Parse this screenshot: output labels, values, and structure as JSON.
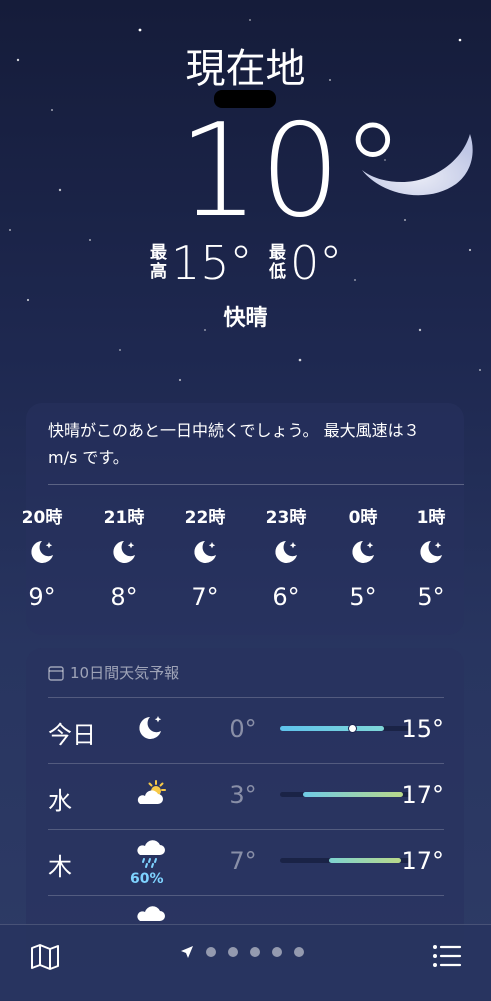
{
  "header": {
    "location": "現在地",
    "temperature": "10°",
    "high_label_1": "最",
    "high_label_2": "高",
    "high": "15°",
    "low_label_1": "最",
    "low_label_2": "低",
    "low": "0°",
    "condition": "快晴"
  },
  "hourly": {
    "summary": "快晴がこのあと一日中続くでしょう。 最大風速は３ m/s です。",
    "items": [
      {
        "time": "20時",
        "icon": "moon-stars-icon",
        "temp": "9°"
      },
      {
        "time": "21時",
        "icon": "moon-stars-icon",
        "temp": "8°"
      },
      {
        "time": "22時",
        "icon": "moon-stars-icon",
        "temp": "7°"
      },
      {
        "time": "23時",
        "icon": "moon-stars-icon",
        "temp": "6°"
      },
      {
        "time": "0時",
        "icon": "moon-stars-icon",
        "temp": "5°"
      },
      {
        "time": "1時",
        "icon": "moon-stars-icon",
        "temp": "5°"
      }
    ]
  },
  "forecast": {
    "title": "10日間天気予報",
    "days": [
      {
        "day": "今日",
        "icon": "moon-stars-icon",
        "low": "0°",
        "high": "15°",
        "range_start": 0.0,
        "range_end": 0.8,
        "current": 0.55,
        "fill": "linear-gradient(90deg,#5fc3ec,#7fd7d8)"
      },
      {
        "day": "水",
        "icon": "partly-sunny-icon",
        "low": "3°",
        "high": "17°",
        "range_start": 0.18,
        "range_end": 0.95,
        "fill": "linear-gradient(90deg,#6fcbe6,#b9d98a)"
      },
      {
        "day": "木",
        "icon": "rain-cloud-icon",
        "probability": "60%",
        "low": "7°",
        "high": "17°",
        "range_start": 0.38,
        "range_end": 0.93,
        "fill": "linear-gradient(90deg,#7ed3d0,#b9d98a)"
      }
    ]
  },
  "colors": {
    "background_top": "#151c3a",
    "background_bottom": "#2e3b66",
    "rain_probability": "#7fd3ff"
  },
  "tabbar": {
    "map_icon": "map-icon",
    "location_icon": "location-arrow-icon",
    "list_icon": "list-icon",
    "page_count": 5
  }
}
